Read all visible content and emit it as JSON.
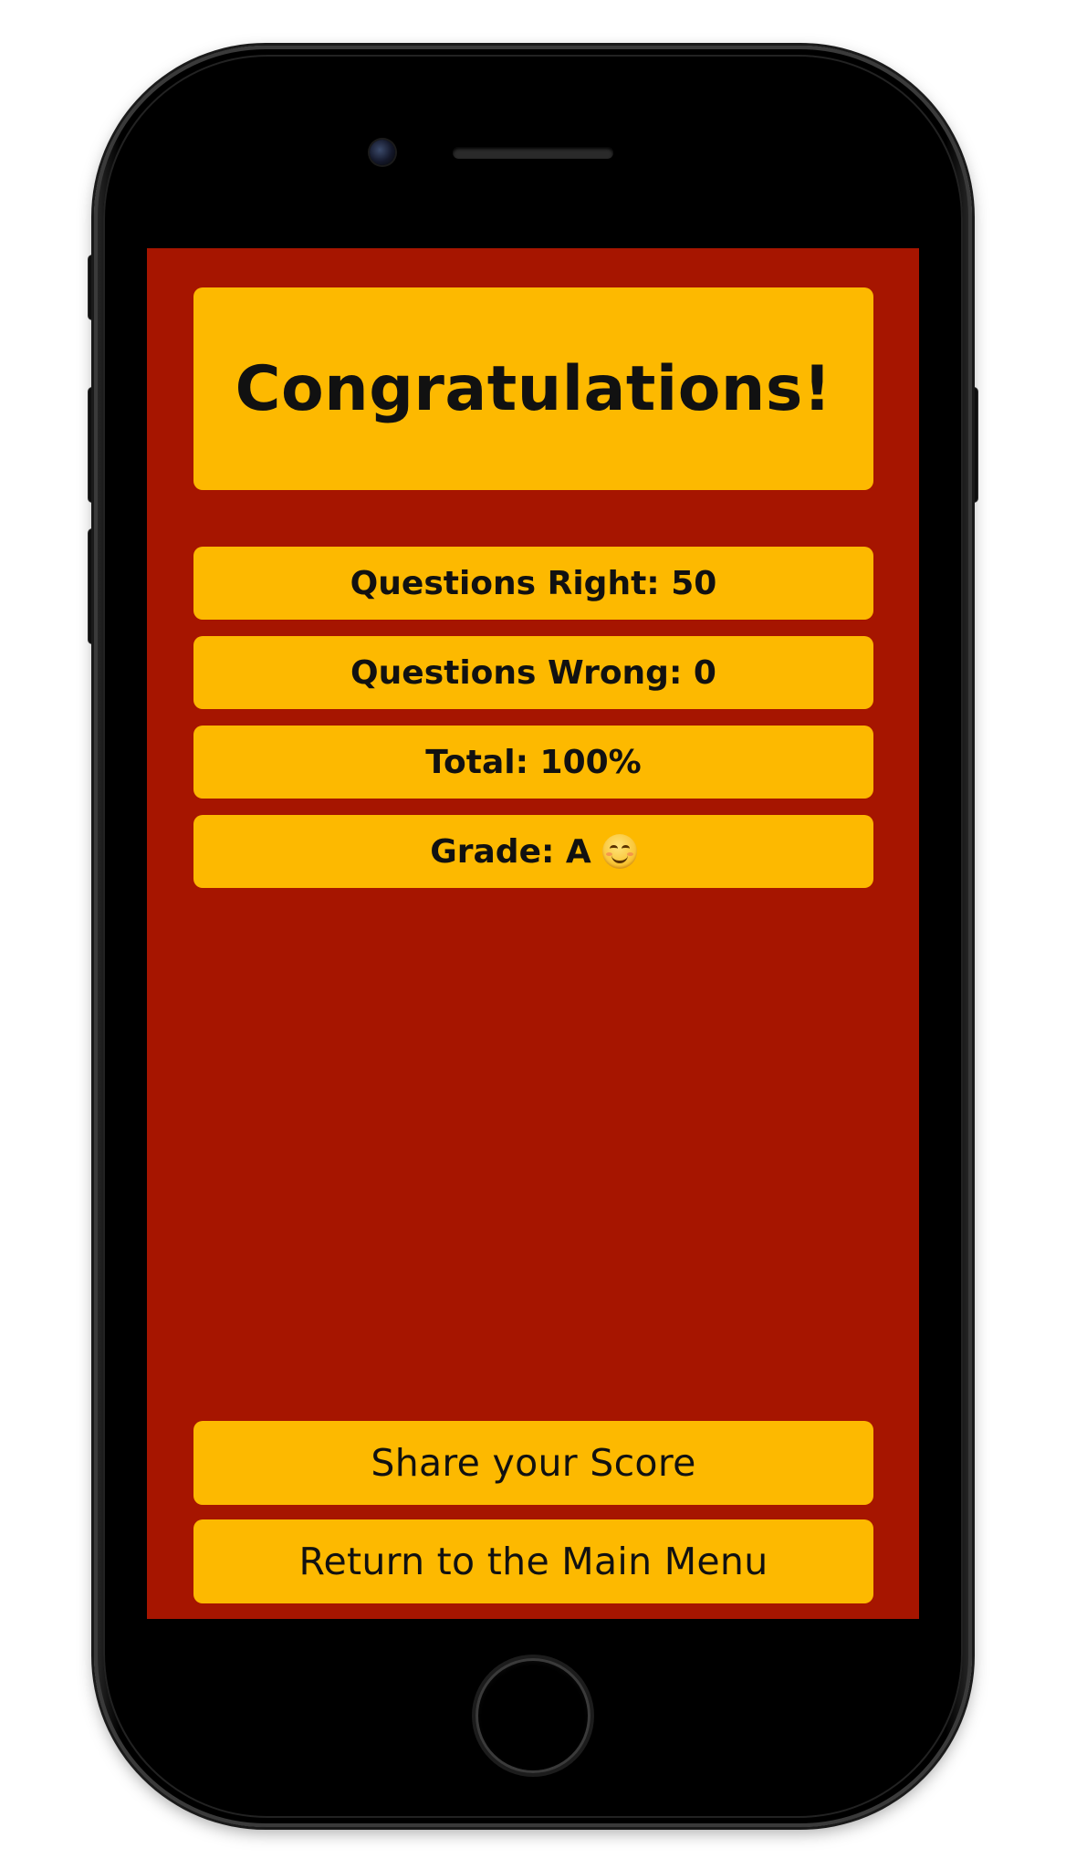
{
  "screen": {
    "title": "Congratulations!",
    "stats": [
      {
        "label": "Questions Right: 50"
      },
      {
        "label": "Questions Wrong: 0"
      },
      {
        "label": "Total: 100%"
      },
      {
        "label": "Grade: A"
      }
    ],
    "grade_emoji": "smiling-face-with-smiling-eyes",
    "actions": {
      "share_label": "Share your Score",
      "menu_label": "Return to the Main Menu"
    }
  },
  "colors": {
    "background": "#a61500",
    "panel": "#fdb900",
    "text": "#111111",
    "device": "#000000"
  }
}
